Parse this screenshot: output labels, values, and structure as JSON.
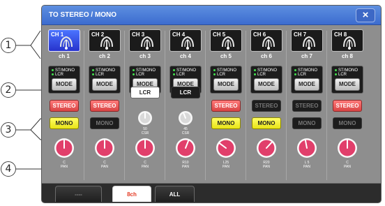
{
  "window": {
    "title": "TO STEREO / MONO",
    "close_symbol": "×"
  },
  "callouts": [
    "1",
    "2",
    "3",
    "4"
  ],
  "channels": [
    {
      "id": "CH 1",
      "name": "ch 1",
      "selected": true,
      "mode_lines": [
        "ST/MONO",
        "LCR"
      ],
      "mode_label": "MODE",
      "stereo": "STEREO",
      "stereo_on": true,
      "mono": "MONO",
      "mono_on": true,
      "pan_value": "C",
      "pan_label": "PAN",
      "pan_level": 0
    },
    {
      "id": "CH 2",
      "name": "ch 2",
      "selected": false,
      "mode_lines": [
        "ST/MONO",
        "LCR"
      ],
      "mode_label": "MODE",
      "stereo": "STEREO",
      "stereo_on": true,
      "mono": "MONO",
      "mono_on": false,
      "pan_value": "C",
      "pan_label": "PAN",
      "pan_level": 0
    },
    {
      "id": "CH 3",
      "name": "ch 3",
      "selected": false,
      "mode_lines": [
        "ST/MONO",
        "LCR"
      ],
      "mode_label": "MODE",
      "lcr": "LCR",
      "lcr_on": true,
      "csr_value": "50",
      "csr_label": "CSR",
      "pan_value": "C",
      "pan_label": "PAN",
      "pan_level": 0
    },
    {
      "id": "CH 4",
      "name": "ch 4",
      "selected": false,
      "mode_lines": [
        "ST/MONO",
        "LCR"
      ],
      "mode_label": "MODE",
      "lcr": "LCR",
      "lcr_on": false,
      "csr_value": "45",
      "csr_label": "CSR",
      "pan_value": "R10",
      "pan_label": "PAN",
      "pan_level": 10
    },
    {
      "id": "CH 5",
      "name": "ch 5",
      "selected": false,
      "mode_lines": [
        "ST/MONO",
        "LCR"
      ],
      "mode_label": "MODE",
      "stereo": "STEREO",
      "stereo_on": true,
      "mono": "MONO",
      "mono_on": true,
      "pan_value": "L25",
      "pan_label": "PAN",
      "pan_level": -25
    },
    {
      "id": "CH 6",
      "name": "ch 6",
      "selected": false,
      "mode_lines": [
        "ST/MONO",
        "LCR"
      ],
      "mode_label": "MODE",
      "stereo": "STEREO",
      "stereo_on": false,
      "mono": "MONO",
      "mono_on": true,
      "pan_value": "R20",
      "pan_label": "PAN",
      "pan_level": 20
    },
    {
      "id": "CH 7",
      "name": "ch 7",
      "selected": false,
      "mode_lines": [
        "ST/MONO",
        "LCR"
      ],
      "mode_label": "MODE",
      "stereo": "STEREO",
      "stereo_on": false,
      "mono": "MONO",
      "mono_on": false,
      "pan_value": "L 5",
      "pan_label": "PAN",
      "pan_level": -5
    },
    {
      "id": "CH 8",
      "name": "ch 8",
      "selected": false,
      "mode_lines": [
        "ST/MONO",
        "LCR"
      ],
      "mode_label": "MODE",
      "stereo": "STEREO",
      "stereo_on": true,
      "mono": "MONO",
      "mono_on": false,
      "pan_value": "C",
      "pan_label": "PAN",
      "pan_level": 0
    }
  ],
  "tabs": [
    {
      "label": "----",
      "active": false
    },
    {
      "label": "8ch",
      "active": true
    },
    {
      "label": "ALL",
      "active": false
    }
  ]
}
